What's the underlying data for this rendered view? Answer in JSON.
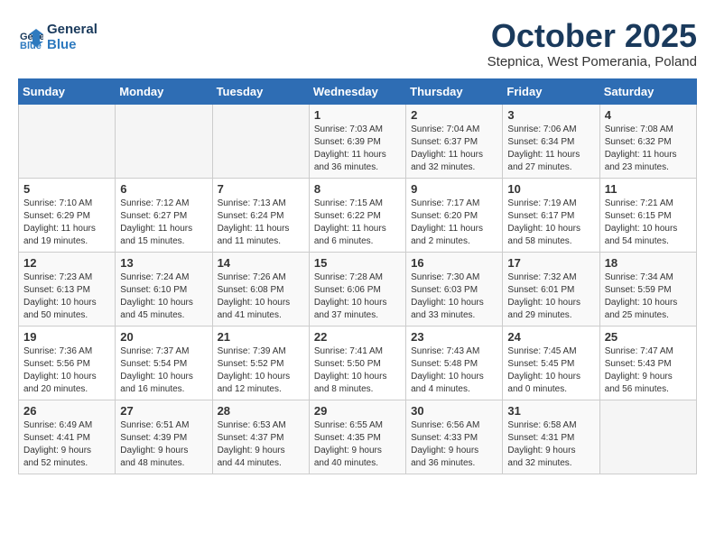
{
  "logo": {
    "line1": "General",
    "line2": "Blue"
  },
  "title": "October 2025",
  "subtitle": "Stepnica, West Pomerania, Poland",
  "weekdays": [
    "Sunday",
    "Monday",
    "Tuesday",
    "Wednesday",
    "Thursday",
    "Friday",
    "Saturday"
  ],
  "weeks": [
    [
      {
        "day": "",
        "info": ""
      },
      {
        "day": "",
        "info": ""
      },
      {
        "day": "",
        "info": ""
      },
      {
        "day": "1",
        "info": "Sunrise: 7:03 AM\nSunset: 6:39 PM\nDaylight: 11 hours\nand 36 minutes."
      },
      {
        "day": "2",
        "info": "Sunrise: 7:04 AM\nSunset: 6:37 PM\nDaylight: 11 hours\nand 32 minutes."
      },
      {
        "day": "3",
        "info": "Sunrise: 7:06 AM\nSunset: 6:34 PM\nDaylight: 11 hours\nand 27 minutes."
      },
      {
        "day": "4",
        "info": "Sunrise: 7:08 AM\nSunset: 6:32 PM\nDaylight: 11 hours\nand 23 minutes."
      }
    ],
    [
      {
        "day": "5",
        "info": "Sunrise: 7:10 AM\nSunset: 6:29 PM\nDaylight: 11 hours\nand 19 minutes."
      },
      {
        "day": "6",
        "info": "Sunrise: 7:12 AM\nSunset: 6:27 PM\nDaylight: 11 hours\nand 15 minutes."
      },
      {
        "day": "7",
        "info": "Sunrise: 7:13 AM\nSunset: 6:24 PM\nDaylight: 11 hours\nand 11 minutes."
      },
      {
        "day": "8",
        "info": "Sunrise: 7:15 AM\nSunset: 6:22 PM\nDaylight: 11 hours\nand 6 minutes."
      },
      {
        "day": "9",
        "info": "Sunrise: 7:17 AM\nSunset: 6:20 PM\nDaylight: 11 hours\nand 2 minutes."
      },
      {
        "day": "10",
        "info": "Sunrise: 7:19 AM\nSunset: 6:17 PM\nDaylight: 10 hours\nand 58 minutes."
      },
      {
        "day": "11",
        "info": "Sunrise: 7:21 AM\nSunset: 6:15 PM\nDaylight: 10 hours\nand 54 minutes."
      }
    ],
    [
      {
        "day": "12",
        "info": "Sunrise: 7:23 AM\nSunset: 6:13 PM\nDaylight: 10 hours\nand 50 minutes."
      },
      {
        "day": "13",
        "info": "Sunrise: 7:24 AM\nSunset: 6:10 PM\nDaylight: 10 hours\nand 45 minutes."
      },
      {
        "day": "14",
        "info": "Sunrise: 7:26 AM\nSunset: 6:08 PM\nDaylight: 10 hours\nand 41 minutes."
      },
      {
        "day": "15",
        "info": "Sunrise: 7:28 AM\nSunset: 6:06 PM\nDaylight: 10 hours\nand 37 minutes."
      },
      {
        "day": "16",
        "info": "Sunrise: 7:30 AM\nSunset: 6:03 PM\nDaylight: 10 hours\nand 33 minutes."
      },
      {
        "day": "17",
        "info": "Sunrise: 7:32 AM\nSunset: 6:01 PM\nDaylight: 10 hours\nand 29 minutes."
      },
      {
        "day": "18",
        "info": "Sunrise: 7:34 AM\nSunset: 5:59 PM\nDaylight: 10 hours\nand 25 minutes."
      }
    ],
    [
      {
        "day": "19",
        "info": "Sunrise: 7:36 AM\nSunset: 5:56 PM\nDaylight: 10 hours\nand 20 minutes."
      },
      {
        "day": "20",
        "info": "Sunrise: 7:37 AM\nSunset: 5:54 PM\nDaylight: 10 hours\nand 16 minutes."
      },
      {
        "day": "21",
        "info": "Sunrise: 7:39 AM\nSunset: 5:52 PM\nDaylight: 10 hours\nand 12 minutes."
      },
      {
        "day": "22",
        "info": "Sunrise: 7:41 AM\nSunset: 5:50 PM\nDaylight: 10 hours\nand 8 minutes."
      },
      {
        "day": "23",
        "info": "Sunrise: 7:43 AM\nSunset: 5:48 PM\nDaylight: 10 hours\nand 4 minutes."
      },
      {
        "day": "24",
        "info": "Sunrise: 7:45 AM\nSunset: 5:45 PM\nDaylight: 10 hours\nand 0 minutes."
      },
      {
        "day": "25",
        "info": "Sunrise: 7:47 AM\nSunset: 5:43 PM\nDaylight: 9 hours\nand 56 minutes."
      }
    ],
    [
      {
        "day": "26",
        "info": "Sunrise: 6:49 AM\nSunset: 4:41 PM\nDaylight: 9 hours\nand 52 minutes."
      },
      {
        "day": "27",
        "info": "Sunrise: 6:51 AM\nSunset: 4:39 PM\nDaylight: 9 hours\nand 48 minutes."
      },
      {
        "day": "28",
        "info": "Sunrise: 6:53 AM\nSunset: 4:37 PM\nDaylight: 9 hours\nand 44 minutes."
      },
      {
        "day": "29",
        "info": "Sunrise: 6:55 AM\nSunset: 4:35 PM\nDaylight: 9 hours\nand 40 minutes."
      },
      {
        "day": "30",
        "info": "Sunrise: 6:56 AM\nSunset: 4:33 PM\nDaylight: 9 hours\nand 36 minutes."
      },
      {
        "day": "31",
        "info": "Sunrise: 6:58 AM\nSunset: 4:31 PM\nDaylight: 9 hours\nand 32 minutes."
      },
      {
        "day": "",
        "info": ""
      }
    ]
  ]
}
